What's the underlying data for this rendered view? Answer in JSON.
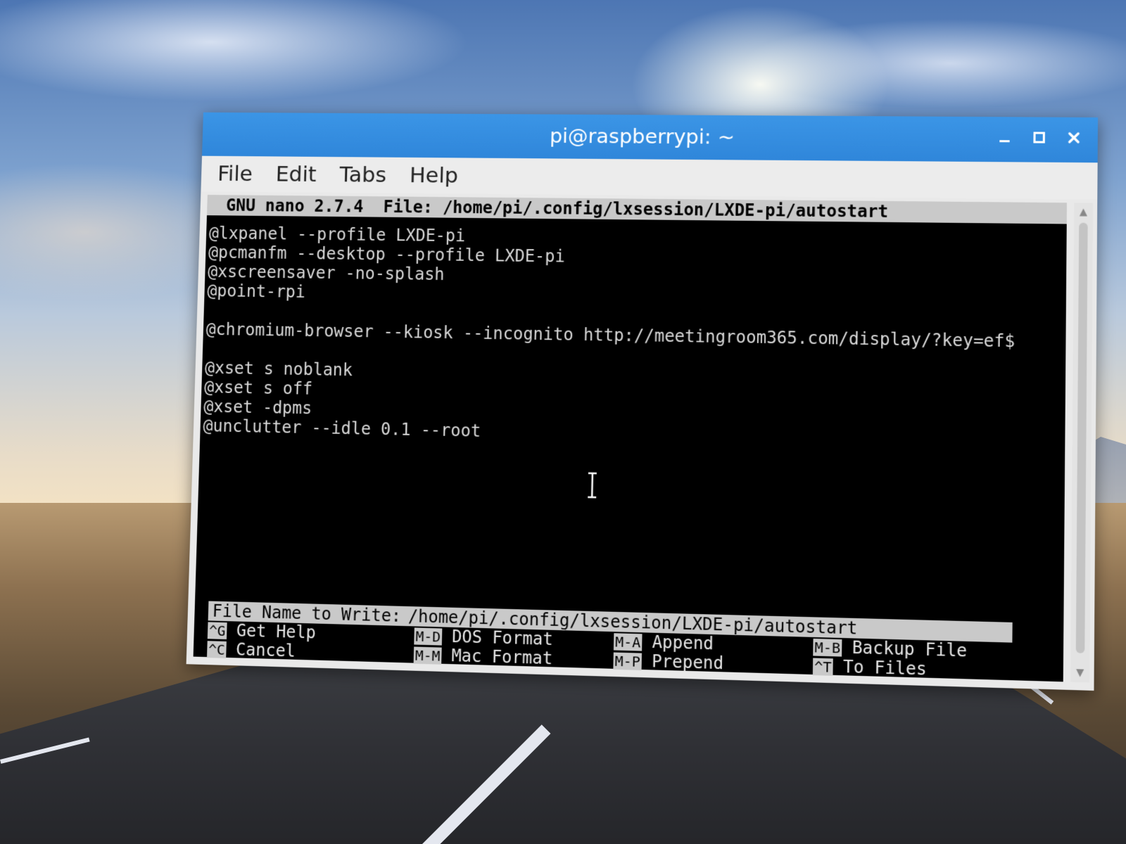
{
  "window": {
    "title": "pi@raspberrypi: ~",
    "controls": [
      "minimize-icon",
      "maximize-icon",
      "close-icon"
    ]
  },
  "menubar": {
    "items": [
      "File",
      "Edit",
      "Tabs",
      "Help"
    ]
  },
  "nano": {
    "header": "GNU nano 2.7.4  File: /home/pi/.config/lxsession/LXDE-pi/autostart",
    "lines": [
      "@lxpanel --profile LXDE-pi",
      "@pcmanfm --desktop --profile LXDE-pi",
      "@xscreensaver -no-splash",
      "@point-rpi",
      "",
      "@chromium-browser --kiosk --incognito http://meetingroom365.com/display/?key=ef$",
      "",
      "@xset s noblank",
      "@xset s off",
      "@xset -dpms",
      "@unclutter --idle 0.1 --root"
    ],
    "prompt": {
      "label": "File Name to Write:",
      "value": "/home/pi/.config/lxsession/LXDE-pi/autostart"
    },
    "shortcuts": [
      {
        "key": "^G",
        "label": "Get Help"
      },
      {
        "key": "M-D",
        "label": "DOS Format"
      },
      {
        "key": "M-A",
        "label": "Append"
      },
      {
        "key": "M-B",
        "label": "Backup File"
      },
      {
        "key": "^C",
        "label": "Cancel"
      },
      {
        "key": "M-M",
        "label": "Mac Format"
      },
      {
        "key": "M-P",
        "label": "Prepend"
      },
      {
        "key": "^T",
        "label": "To Files"
      }
    ]
  },
  "colors": {
    "titlebar": "#3b95e6",
    "terminal_bg": "#000000",
    "terminal_fg": "#d8d8d8",
    "nano_bar": "#c9c9c9"
  }
}
